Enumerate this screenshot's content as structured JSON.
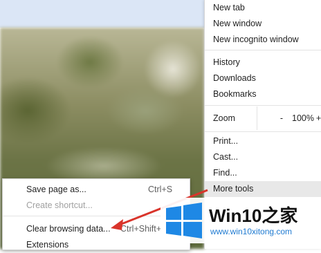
{
  "main_menu": {
    "items_top": [
      "New tab",
      "New window",
      "New incognito window"
    ],
    "items_mid": [
      "History",
      "Downloads",
      "Bookmarks"
    ],
    "zoom": {
      "label": "Zoom",
      "minus": "-",
      "value": "100%",
      "plus": "+"
    },
    "items_bottom": [
      "Print...",
      "Cast...",
      "Find...",
      "More tools"
    ]
  },
  "sub_menu": {
    "save_page": {
      "label": "Save page as...",
      "shortcut": "Ctrl+S"
    },
    "create_shortcut": {
      "label": "Create shortcut..."
    },
    "clear_data": {
      "label": "Clear browsing data...",
      "shortcut": "Ctrl+Shift+"
    },
    "extensions": {
      "label": "Extensions"
    }
  },
  "watermark": {
    "title": "Win10之家",
    "url": "www.win10xitong.com",
    "colors": {
      "logo": "#1e88e5",
      "arrow": "#d9342b"
    }
  }
}
